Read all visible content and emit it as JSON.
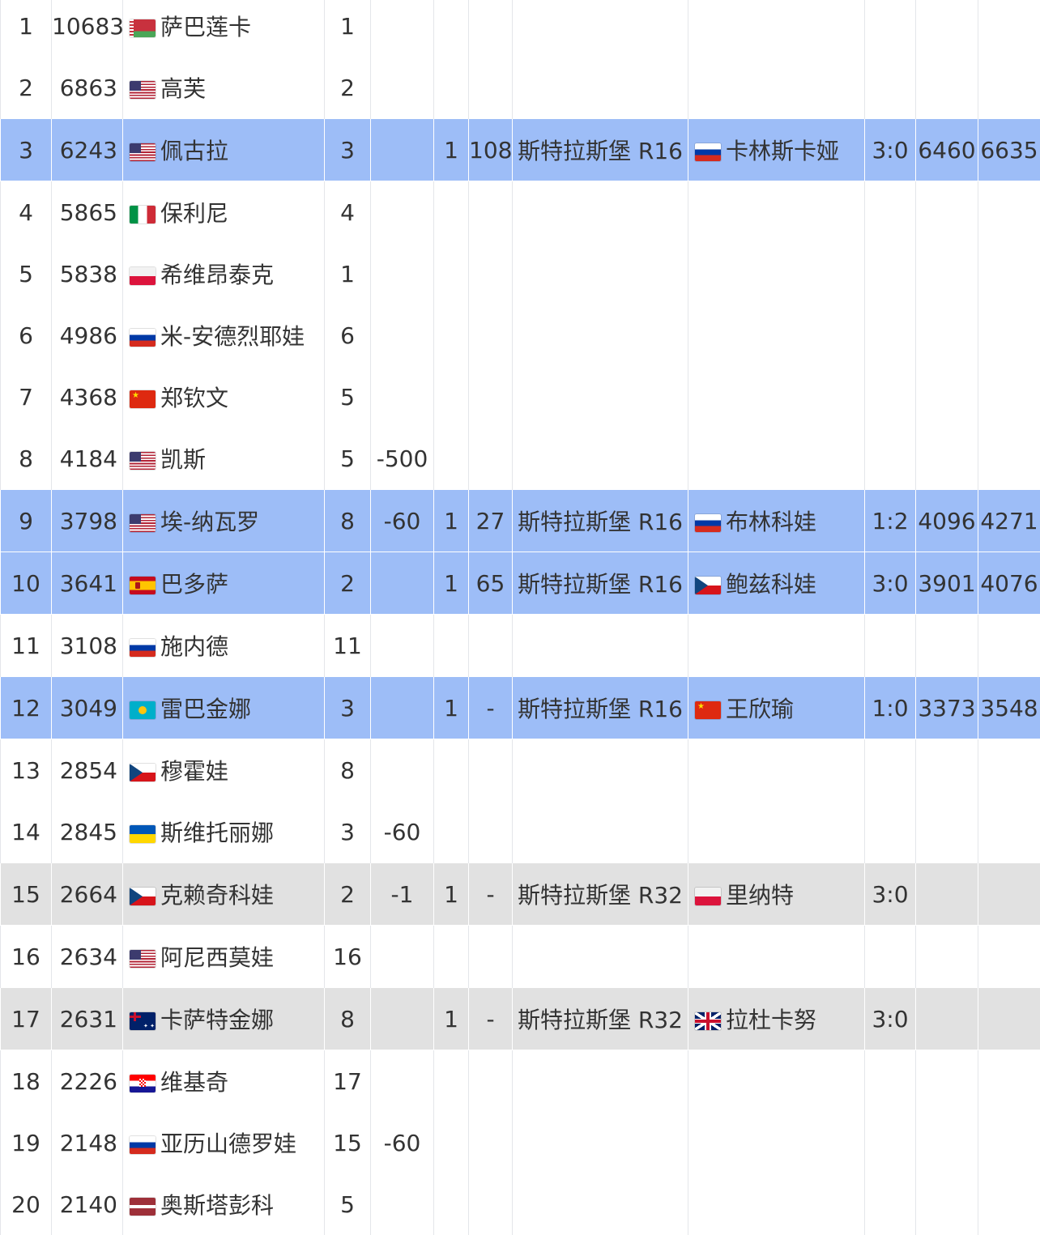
{
  "rows": [
    {
      "rank": "1",
      "points": "10683",
      "flag": "by",
      "name": "萨巴莲卡",
      "c4": "1",
      "c5": "",
      "c6": "",
      "c7": "",
      "c8": "",
      "opp_flag": "",
      "opp": "",
      "c10": "",
      "c11": "",
      "c12": "",
      "style": "plain"
    },
    {
      "rank": "2",
      "points": "6863",
      "flag": "us",
      "name": "高芙",
      "c4": "2",
      "c5": "",
      "c6": "",
      "c7": "",
      "c8": "",
      "opp_flag": "",
      "opp": "",
      "c10": "",
      "c11": "",
      "c12": "",
      "style": "plain"
    },
    {
      "rank": "3",
      "points": "6243",
      "flag": "us",
      "name": "佩古拉",
      "c4": "3",
      "c5": "",
      "c6": "1",
      "c7": "108",
      "c8": "斯特拉斯堡 R16",
      "opp_flag": "ru",
      "opp": "卡林斯卡娅",
      "c10": "3:0",
      "c11": "6460",
      "c12": "6635",
      "style": "blue"
    },
    {
      "rank": "4",
      "points": "5865",
      "flag": "it",
      "name": "保利尼",
      "c4": "4",
      "c5": "",
      "c6": "",
      "c7": "",
      "c8": "",
      "opp_flag": "",
      "opp": "",
      "c10": "",
      "c11": "",
      "c12": "",
      "style": "plain"
    },
    {
      "rank": "5",
      "points": "5838",
      "flag": "pl",
      "name": "希维昂泰克",
      "c4": "1",
      "c5": "",
      "c6": "",
      "c7": "",
      "c8": "",
      "opp_flag": "",
      "opp": "",
      "c10": "",
      "c11": "",
      "c12": "",
      "style": "plain"
    },
    {
      "rank": "6",
      "points": "4986",
      "flag": "ru",
      "name": "米-安德烈耶娃",
      "c4": "6",
      "c5": "",
      "c6": "",
      "c7": "",
      "c8": "",
      "opp_flag": "",
      "opp": "",
      "c10": "",
      "c11": "",
      "c12": "",
      "style": "plain"
    },
    {
      "rank": "7",
      "points": "4368",
      "flag": "cn",
      "name": "郑钦文",
      "c4": "5",
      "c5": "",
      "c6": "",
      "c7": "",
      "c8": "",
      "opp_flag": "",
      "opp": "",
      "c10": "",
      "c11": "",
      "c12": "",
      "style": "plain"
    },
    {
      "rank": "8",
      "points": "4184",
      "flag": "us",
      "name": "凯斯",
      "c4": "5",
      "c5": "-500",
      "c6": "",
      "c7": "",
      "c8": "",
      "opp_flag": "",
      "opp": "",
      "c10": "",
      "c11": "",
      "c12": "",
      "style": "plain"
    },
    {
      "rank": "9",
      "points": "3798",
      "flag": "us",
      "name": "埃-纳瓦罗",
      "c4": "8",
      "c5": "-60",
      "c6": "1",
      "c7": "27",
      "c8": "斯特拉斯堡 R16",
      "opp_flag": "ru",
      "opp": "布林科娃",
      "c10": "1:2",
      "c11": "4096",
      "c12": "4271",
      "style": "blue"
    },
    {
      "rank": "10",
      "points": "3641",
      "flag": "es",
      "name": "巴多萨",
      "c4": "2",
      "c5": "",
      "c6": "1",
      "c7": "65",
      "c8": "斯特拉斯堡 R16",
      "opp_flag": "cz",
      "opp": "鲍兹科娃",
      "c10": "3:0",
      "c11": "3901",
      "c12": "4076",
      "style": "blue"
    },
    {
      "rank": "11",
      "points": "3108",
      "flag": "ru",
      "name": "施内德",
      "c4": "11",
      "c5": "",
      "c6": "",
      "c7": "",
      "c8": "",
      "opp_flag": "",
      "opp": "",
      "c10": "",
      "c11": "",
      "c12": "",
      "style": "plain"
    },
    {
      "rank": "12",
      "points": "3049",
      "flag": "kz",
      "name": "雷巴金娜",
      "c4": "3",
      "c5": "",
      "c6": "1",
      "c7": "-",
      "c8": "斯特拉斯堡 R16",
      "opp_flag": "cn",
      "opp": "王欣瑜",
      "c10": "1:0",
      "c11": "3373",
      "c12": "3548",
      "style": "blue"
    },
    {
      "rank": "13",
      "points": "2854",
      "flag": "cz",
      "name": "穆霍娃",
      "c4": "8",
      "c5": "",
      "c6": "",
      "c7": "",
      "c8": "",
      "opp_flag": "",
      "opp": "",
      "c10": "",
      "c11": "",
      "c12": "",
      "style": "plain"
    },
    {
      "rank": "14",
      "points": "2845",
      "flag": "ua",
      "name": "斯维托丽娜",
      "c4": "3",
      "c5": "-60",
      "c6": "",
      "c7": "",
      "c8": "",
      "opp_flag": "",
      "opp": "",
      "c10": "",
      "c11": "",
      "c12": "",
      "style": "plain"
    },
    {
      "rank": "15",
      "points": "2664",
      "flag": "cz",
      "name": "克赖奇科娃",
      "c4": "2",
      "c5": "-1",
      "c6": "1",
      "c7": "-",
      "c8": "斯特拉斯堡 R32",
      "opp_flag": "pl",
      "opp": "里纳特",
      "c10": "3:0",
      "c11": "",
      "c12": "",
      "style": "grey"
    },
    {
      "rank": "16",
      "points": "2634",
      "flag": "us",
      "name": "阿尼西莫娃",
      "c4": "16",
      "c5": "",
      "c6": "",
      "c7": "",
      "c8": "",
      "opp_flag": "",
      "opp": "",
      "c10": "",
      "c11": "",
      "c12": "",
      "style": "plain"
    },
    {
      "rank": "17",
      "points": "2631",
      "flag": "au",
      "name": "卡萨特金娜",
      "c4": "8",
      "c5": "",
      "c6": "1",
      "c7": "-",
      "c8": "斯特拉斯堡 R32",
      "opp_flag": "gb",
      "opp": "拉杜卡努",
      "c10": "3:0",
      "c11": "",
      "c12": "",
      "style": "grey"
    },
    {
      "rank": "18",
      "points": "2226",
      "flag": "hr",
      "name": "维基奇",
      "c4": "17",
      "c5": "",
      "c6": "",
      "c7": "",
      "c8": "",
      "opp_flag": "",
      "opp": "",
      "c10": "",
      "c11": "",
      "c12": "",
      "style": "plain"
    },
    {
      "rank": "19",
      "points": "2148",
      "flag": "ru",
      "name": "亚历山德罗娃",
      "c4": "15",
      "c5": "-60",
      "c6": "",
      "c7": "",
      "c8": "",
      "opp_flag": "",
      "opp": "",
      "c10": "",
      "c11": "",
      "c12": "",
      "style": "plain"
    },
    {
      "rank": "20",
      "points": "2140",
      "flag": "lv",
      "name": "奥斯塔彭科",
      "c4": "5",
      "c5": "",
      "c6": "",
      "c7": "",
      "c8": "",
      "opp_flag": "",
      "opp": "",
      "c10": "",
      "c11": "",
      "c12": "",
      "style": "plain"
    }
  ],
  "colors": {
    "blue_row": "#9dbdf7",
    "grey_row": "#e1e1e1",
    "grid": "#e4e6ea",
    "text": "#333333"
  }
}
